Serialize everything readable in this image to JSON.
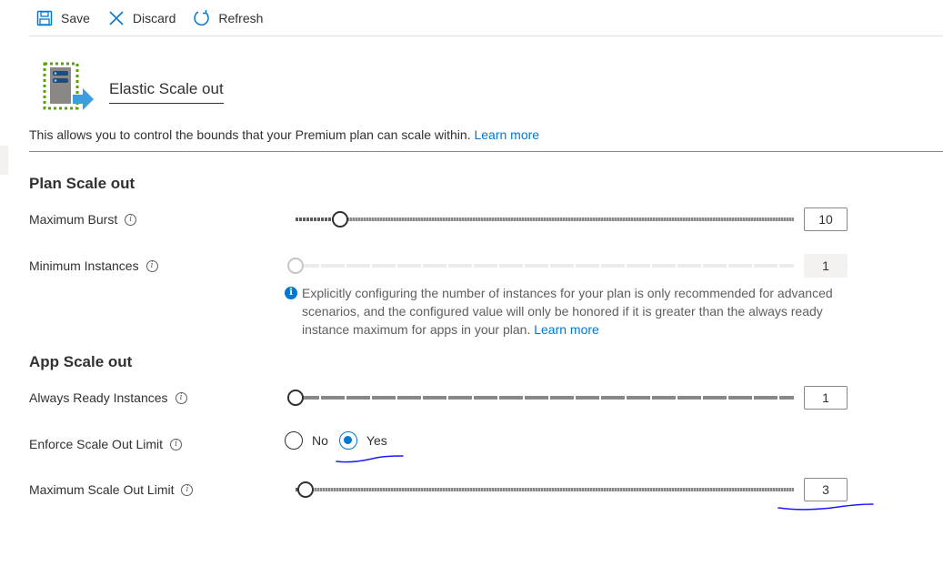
{
  "toolbar": {
    "save_label": "Save",
    "discard_label": "Discard",
    "refresh_label": "Refresh"
  },
  "header": {
    "title": "Elastic Scale out"
  },
  "description": {
    "text": "This allows you to control the bounds that your Premium plan can scale within.",
    "link": "Learn more"
  },
  "plan_scale_out": {
    "title": "Plan Scale out",
    "maximum_burst": {
      "label": "Maximum Burst",
      "value": "10",
      "slider_fraction": 0.09
    },
    "minimum_instances": {
      "label": "Minimum Instances",
      "value": "1",
      "slider_fraction": 0.0,
      "disabled": true
    },
    "note": {
      "text": "Explicitly configuring the number of instances for your plan is only recommended for advanced scenarios, and the configured value will only be honored if it is greater than the always ready instance maximum for apps in your plan.",
      "link": "Learn more"
    }
  },
  "app_scale_out": {
    "title": "App Scale out",
    "always_ready_instances": {
      "label": "Always Ready Instances",
      "value": "1",
      "slider_fraction": 0.0
    },
    "enforce_scale_out_limit": {
      "label": "Enforce Scale Out Limit",
      "options": [
        "No",
        "Yes"
      ],
      "selected": "Yes"
    },
    "maximum_scale_out_limit": {
      "label": "Maximum Scale Out Limit",
      "value": "3",
      "slider_fraction": 0.02
    }
  },
  "colors": {
    "accent": "#0078d4",
    "annotation_ink": "#1a1aff"
  },
  "icons": [
    "save-icon",
    "discard-icon",
    "refresh-icon",
    "elastic-scale-icon",
    "info-icon"
  ]
}
